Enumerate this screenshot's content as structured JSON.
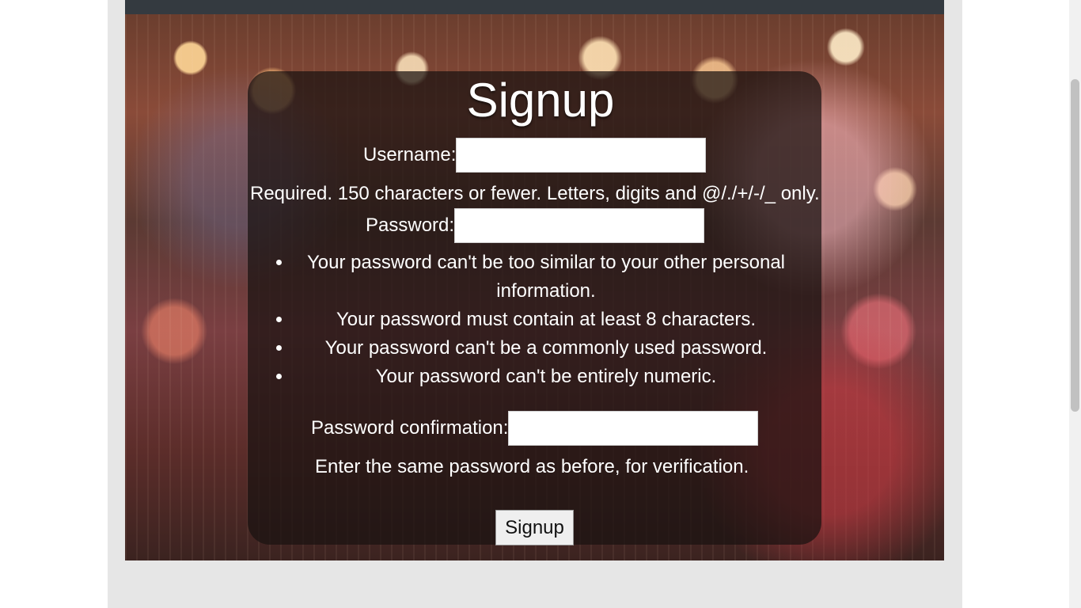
{
  "page": {
    "title": "Signup"
  },
  "form": {
    "username_label": "Username:",
    "username_value": "",
    "username_help": "Required. 150 characters or fewer. Letters, digits and @/./+/-/_ only.",
    "password_label": "Password:",
    "password_value": "",
    "password_rules": [
      "Your password can't be too similar to your other personal information.",
      "Your password must contain at least 8 characters.",
      "Your password can't be a commonly used password.",
      "Your password can't be entirely numeric."
    ],
    "password2_label": "Password confirmation:",
    "password2_value": "",
    "password2_help": "Enter the same password as before, for verification.",
    "submit_label": "Signup"
  },
  "colors": {
    "topbar": "#343a40",
    "card_background": "rgba(25,18,16,0.72)",
    "text": "#ffffff",
    "page_background": "#e6e6e6"
  }
}
